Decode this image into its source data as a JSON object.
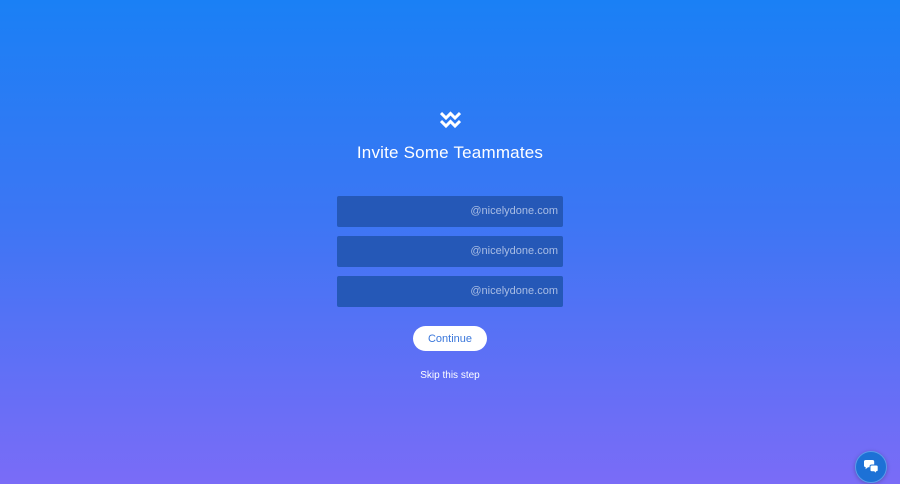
{
  "branding": {
    "logo_icon": "double-zigzag-logo-icon"
  },
  "page": {
    "title": "Invite Some Teammates"
  },
  "invite_fields": [
    {
      "value": "",
      "domain_suffix": "@nicelydone.com"
    },
    {
      "value": "",
      "domain_suffix": "@nicelydone.com"
    },
    {
      "value": "",
      "domain_suffix": "@nicelydone.com"
    }
  ],
  "actions": {
    "continue_label": "Continue",
    "skip_label": "Skip this step"
  },
  "chat_widget": {
    "icon": "chat-bubbles-icon"
  },
  "colors": {
    "background_top": "#1a80f5",
    "background_bottom": "#7a6cf7",
    "field_background": "#2558b7",
    "button_text": "#3a77db"
  }
}
